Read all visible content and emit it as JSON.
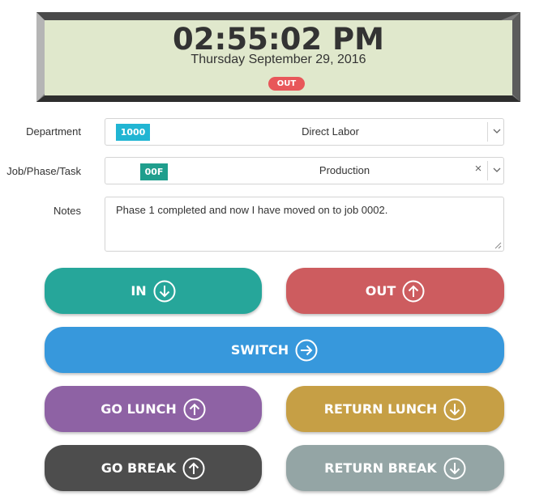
{
  "clock": {
    "time": "02:55:02 PM",
    "date": "Thursday September 29, 2016",
    "status": "OUT"
  },
  "form": {
    "department": {
      "label": "Department",
      "code": "1000",
      "value": "Direct Labor"
    },
    "job": {
      "label": "Job/Phase/Task",
      "code": "00F",
      "value": "Production",
      "clear": "×"
    },
    "notes": {
      "label": "Notes",
      "value": "Phase 1 completed and now I have moved on to job 0002."
    }
  },
  "buttons": {
    "in": {
      "label": "IN",
      "icon": "arrow-down-circle-icon",
      "color": "#26a69a"
    },
    "out": {
      "label": "OUT",
      "icon": "arrow-up-circle-icon",
      "color": "#cd5c5f"
    },
    "switch": {
      "label": "SWITCH",
      "icon": "arrow-right-circle-icon",
      "color": "#3798dc"
    },
    "go_lunch": {
      "label": "GO LUNCH",
      "icon": "arrow-up-circle-icon",
      "color": "#8e62a4"
    },
    "return_lunch": {
      "label": "RETURN LUNCH",
      "icon": "arrow-down-circle-icon",
      "color": "#c69f45"
    },
    "go_break": {
      "label": "GO BREAK",
      "icon": "arrow-up-circle-icon",
      "color": "#4d4d4d"
    },
    "return_break": {
      "label": "RETURN BREAK",
      "icon": "arrow-down-circle-icon",
      "color": "#94a5a5"
    }
  },
  "colors": {
    "department_tag": "#21b5d3",
    "job_tag": "#1f9e8d",
    "clock_face": "#e0e8cc",
    "status_badge": "#e8575a"
  }
}
